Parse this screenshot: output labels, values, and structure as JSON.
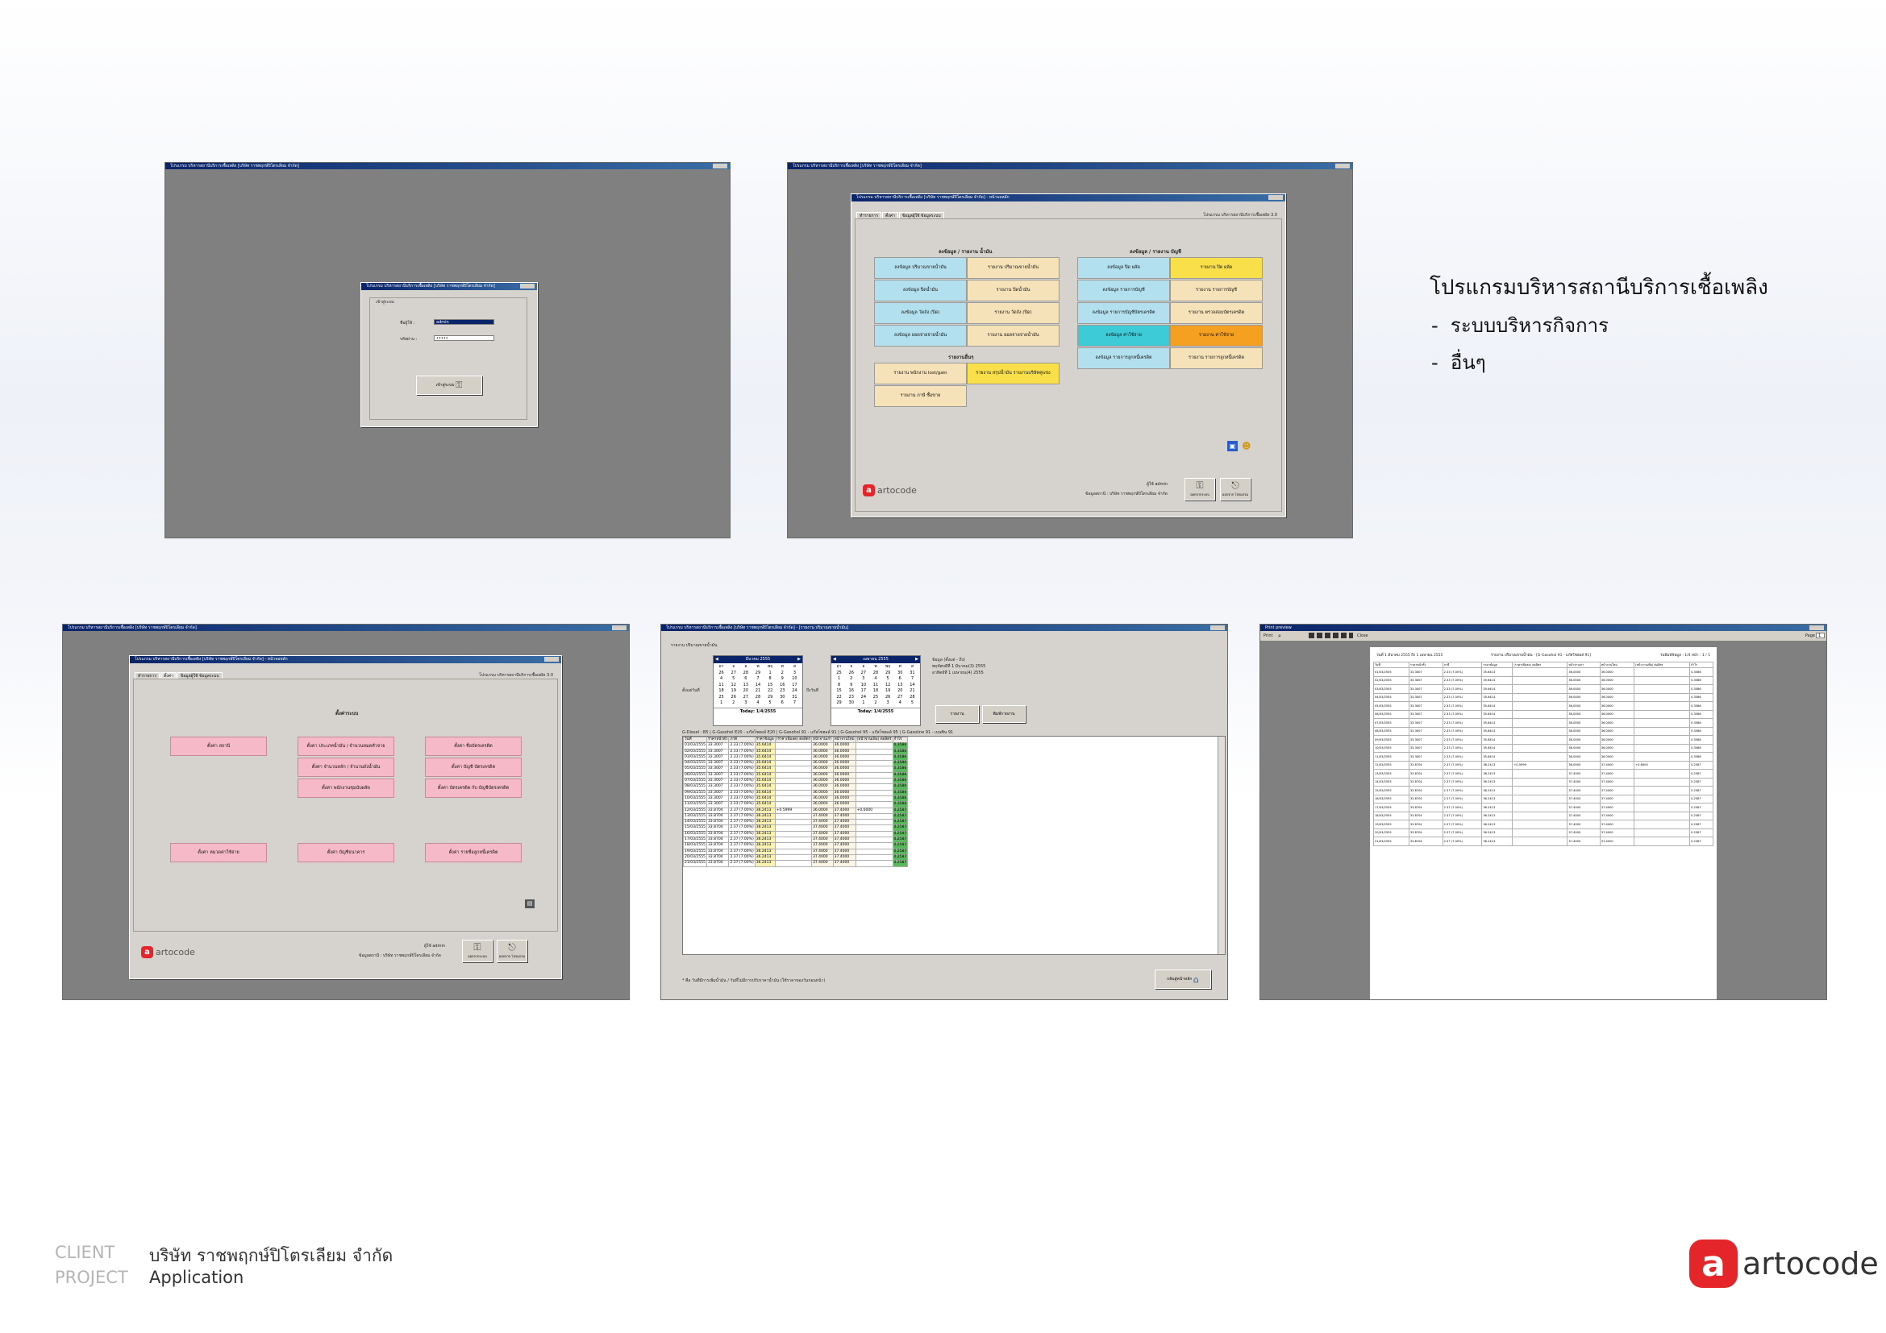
{
  "description_block": {
    "heading": "โปรแกรมบริหารสถานีบริการเชื้อเพลิง",
    "bullets": [
      "ระบบบริหารกิจการ",
      "อื่นๆ"
    ]
  },
  "footer": {
    "client_label": "CLIENT",
    "client_value": "บริษัท ราชพฤกษ์ปิโตรเลียม จำกัด",
    "project_label": "PROJECT",
    "project_value": "Application",
    "brand": "artocode",
    "brand_mark": "a"
  },
  "colors": {
    "brand_red": "#e4252a",
    "desktop_gray": "#808080",
    "dialog_face": "#d6d3ce",
    "titlebar_blue": "#0a246a",
    "menu_blue": "#b3e0ee",
    "menu_beige": "#f6e2b8",
    "menu_yellow": "#f9e04a",
    "menu_cyan": "#3ecbd8",
    "menu_orange": "#f5a020",
    "menu_pink": "#f6b9c8"
  },
  "screen1": {
    "window_title": "โปรแกรม บริหารสถานีบริการเชื้อเพลิง [บริษัท ราชพฤกษ์ปิโตรเลียม จำกัด]",
    "dialog_title": "โปรแกรม บริหารสถานีบริการเชื้อเพลิง [บริษัท ราชพฤกษ์ปิโตรเลียม จำกัด]",
    "group_label": "เข้าสู่ระบบ",
    "username_label": "ชื่อผู้ใช้ :",
    "username_value": "admin",
    "password_label": "รหัสผ่าน :",
    "password_value": "•••••",
    "login_button": "เข้าสู่ระบบ"
  },
  "screen2": {
    "window_title": "โปรแกรม บริหารสถานีบริการเชื้อเพลิง [บริษัท ราชพฤกษ์ปิโตรเลียม จำกัด]",
    "dialog_title": "โปรแกรม บริหารสถานีบริการเชื้อเพลิง [บริษัท ราชพฤกษ์ปิโตรเลียม จำกัด] - หน้าจอหลัก",
    "tabs": [
      "ทำรายการ",
      "ตั้งค่า",
      "ข้อมูลผู้ใช้ ข้อมูลระบบ"
    ],
    "version_text": "โปรแกรม บริหารสถานีบริการเชื้อเพลิง 3.0",
    "section_fuel": "ลงข้อมูล / รายงาน น้ำมัน",
    "section_accounting": "ลงข้อมูล / รายงาน บัญชี",
    "section_other": "รายงานอื่นๆ",
    "fuel_left": [
      "ลงข้อมูล ปริมาณขายน้ำมัน",
      "ลงข้อมูล ปิดน้ำมัน",
      "ลงข้อมูล วัดถัง (ปิด)",
      "ลงข้อมูล ยอดจ่ายจ่ายน้ำมัน"
    ],
    "fuel_right": [
      "รายงาน ปริมาณขายน้ำมัน",
      "รายงาน ปิดน้ำมัน",
      "รายงาน วัดถัง (ปิด)",
      "รายงาน ยอดจ่ายจ่ายน้ำมัน"
    ],
    "acct_left": [
      "ลงข้อมูล ปิด ผลัด",
      "ลงข้อมูล รายการบัญชี",
      "ลงข้อมูล รายการบัญชีบัตรเครดิต",
      "ลงข้อมูล ค่าใช้จ่าย",
      "ลงข้อมูล รายการลูกหนี้เครดิต"
    ],
    "acct_right": [
      "รายงาน ปิด ผลัด",
      "รายงาน รายการบัญชี",
      "รายงาน ตรวจสอบบัตรเครดิต",
      "รายงาน ค่าใช้จ่าย",
      "รายงาน รายการลูกหนี้เครดิต"
    ],
    "other_1": "รายงาน พนักงาน lost/gain",
    "other_2": "รายงาน สรุปน้ำมัน รายงานบริษัทคู่แข่ง",
    "other_3": "รายงาน ภาษี ซื้อขาย",
    "user_label": "ผู้ใช้",
    "user_value": "admin",
    "company_line": "ข้อมูลสถานี : บริษัท ราชพฤกษ์ปิโตรเลียม จำกัด",
    "btn_logout": "ออกจากระบบ",
    "btn_exit": "ออกจาก โปรแกรม",
    "logo_text": "artocode"
  },
  "screen3": {
    "window_title": "โปรแกรม บริหารสถานีบริการเชื้อเพลิง [บริษัท ราชพฤกษ์ปิโตรเลียม จำกัด]",
    "dialog_title": "โปรแกรม บริหารสถานีบริการเชื้อเพลิง [บริษัท ราชพฤกษ์ปิโตรเลียม จำกัด] - หน้าจอหลัก",
    "tabs": [
      "ทำรายการ",
      "ตั้งค่า",
      "ข้อมูลผู้ใช้ ข้อมูลระบบ"
    ],
    "version_text": "โปรแกรม บริหารสถานีบริการเชื้อเพลิง 3.0",
    "section_title": "ตั้งค่าระบบ",
    "buttons": [
      "ตั้งค่า สถานี",
      "ตั้งค่า ประเภทน้ำมัน / จำนวนหมดหัวจ่าย",
      "ตั้งค่า ชื่อบัตรเครดิต",
      "ตั้งค่า จำนวนหลัก / จำนวนถังน้ำมัน",
      "ตั้งค่า บัญชี บัตรเครดิต",
      "ตั้งค่า พนักงานชุมนับผลัด",
      "ตั้งค่า บัตรเครดิต กับ บัญชีบัตรเครดิต",
      "ตั้งค่า หมวดค่าใช้จ่าย",
      "ตั้งค่า บัญชีธนาคาร",
      "ตั้งค่า รายชื่อลูกหนี้เครดิต"
    ],
    "user_label": "ผู้ใช้",
    "user_value": "admin",
    "company_line": "ข้อมูลสถานี : บริษัท ราชพฤกษ์ปิโตรเลียม จำกัด",
    "btn_logout": "ออกจากระบบ",
    "btn_exit": "ออกจาก โปรแกรม",
    "logo_text": "artocode"
  },
  "screen4": {
    "window_title": "โปรแกรม บริหารสถานีบริการเชื้อเพลิง [บริษัท ราชพฤกษ์ปิโตรเลียม จำกัด] - [รายงาน ปริมาณขายน้ำมัน]",
    "report_label": "รายงาน ปริมาณขายน้ำมัน",
    "from_label": "ตั้งแต่วันที่",
    "to_label": "ถึงวันที่",
    "cal1": {
      "month": "มีนาคม 2555",
      "days": [
        "อา",
        "จ",
        "อ",
        "พ",
        "พฤ",
        "ศ",
        "ส"
      ],
      "dates": [
        "26",
        "27",
        "28",
        "29",
        "1",
        "2",
        "3",
        "4",
        "5",
        "6",
        "7",
        "8",
        "9",
        "10",
        "11",
        "12",
        "13",
        "14",
        "15",
        "16",
        "17",
        "18",
        "19",
        "20",
        "21",
        "22",
        "23",
        "24",
        "25",
        "26",
        "27",
        "28",
        "29",
        "30",
        "31",
        "1",
        "2",
        "3",
        "4",
        "5",
        "6",
        "7"
      ],
      "today": "Today: 1/4/2555"
    },
    "cal2": {
      "month": "เมษายน 2555",
      "days": [
        "อา",
        "จ",
        "อ",
        "พ",
        "พฤ",
        "ศ",
        "ส"
      ],
      "dates": [
        "25",
        "26",
        "27",
        "28",
        "29",
        "30",
        "31",
        "1",
        "2",
        "3",
        "4",
        "5",
        "6",
        "7",
        "8",
        "9",
        "10",
        "11",
        "12",
        "13",
        "14",
        "15",
        "16",
        "17",
        "18",
        "19",
        "20",
        "21",
        "22",
        "23",
        "24",
        "25",
        "26",
        "27",
        "28",
        "29",
        "30",
        "1",
        "2",
        "3",
        "4",
        "5"
      ],
      "today": "Today: 1/4/2555"
    },
    "info_lines": [
      "ข้อมูล (ตั้งแต่ - ถึง)",
      "พฤหัสบดีที่ 1 มีนาคม(3) 2555",
      "อาทิตย์ที่ 1 เมษายน(4) 2555"
    ],
    "btn_report": "รายงาน",
    "btn_print": "พิมพ์รายงาน",
    "fuel_tabs_text": "G-Diesel : B5 | G-Gasohol E20 - แก๊สโซฮอล์ E20 | G-Gasohol 91 - แก๊สโซฮอล์ 91 | G-Gasohol 95 - แก๊สโซฮอล์ 95 | G-Gasoline 91 - เบนซิน 91",
    "columns": [
      "วันที่",
      "ราคาหน้าตั๋ว",
      "ภาษี",
      "ราคาข้อมูล",
      "(ราคาเพิ่มลด) ต่อลิตร",
      "หน้าจานเก่า",
      "หน้าจานใหม่",
      "(หน้าจานเพิ่ม) ต่อลิตร",
      "กำไร"
    ],
    "rows": [
      [
        "01/03/2555",
        "33.3007",
        "2.33 (7.00%)",
        "35.6414",
        "",
        "36.0000",
        "36.0000",
        "",
        "0.3586"
      ],
      [
        "02/03/2555",
        "33.3007",
        "2.33 (7.00%)",
        "35.6414",
        "",
        "36.0000",
        "36.0000",
        "",
        "0.3586"
      ],
      [
        "03/03/2555",
        "33.3007",
        "2.33 (7.00%)",
        "35.6414",
        "",
        "36.0000",
        "36.0000",
        "",
        "0.3586"
      ],
      [
        "04/03/2555",
        "33.3007",
        "2.33 (7.00%)",
        "35.6414",
        "",
        "36.0000",
        "36.0000",
        "",
        "0.3586"
      ],
      [
        "05/03/2555",
        "33.3007",
        "2.33 (7.00%)",
        "35.6414",
        "",
        "36.0000",
        "36.0000",
        "",
        "0.3586"
      ],
      [
        "06/03/2555",
        "33.3007",
        "2.33 (7.00%)",
        "35.6414",
        "",
        "36.0000",
        "36.0000",
        "",
        "0.3586"
      ],
      [
        "07/03/2555",
        "33.3007",
        "2.33 (7.00%)",
        "35.6414",
        "",
        "36.0000",
        "36.0000",
        "",
        "0.3586"
      ],
      [
        "08/03/2555",
        "33.3007",
        "2.33 (7.00%)",
        "35.6414",
        "",
        "36.0000",
        "36.0000",
        "",
        "0.3586"
      ],
      [
        "09/03/2555",
        "33.3007",
        "2.33 (7.00%)",
        "35.6414",
        "",
        "36.0000",
        "36.0000",
        "",
        "0.3586"
      ],
      [
        "10/03/2555",
        "33.3007",
        "2.33 (7.00%)",
        "35.6414",
        "",
        "36.0000",
        "36.0000",
        "",
        "0.3586"
      ],
      [
        "11/03/2555",
        "33.3007",
        "2.33 (7.00%)",
        "35.6414",
        "",
        "36.0000",
        "36.0000",
        "",
        "0.3586"
      ],
      [
        "12/03/2555",
        "33.8704",
        "2.37 (7.00%)",
        "36.2413",
        "+0.5999",
        "36.0000",
        "37.4000",
        "+0.6000",
        "0.2587"
      ],
      [
        "13/03/2555",
        "33.8704",
        "2.37 (7.00%)",
        "36.2413",
        "",
        "37.4000",
        "37.4000",
        "",
        "0.2587"
      ],
      [
        "14/03/2555",
        "33.8704",
        "2.37 (7.00%)",
        "36.2413",
        "",
        "37.4000",
        "37.4000",
        "",
        "0.2587"
      ],
      [
        "15/03/2555",
        "33.8704",
        "2.37 (7.00%)",
        "36.2413",
        "",
        "37.4000",
        "37.4000",
        "",
        "0.2587"
      ],
      [
        "16/03/2555",
        "33.8704",
        "2.37 (7.00%)",
        "36.2413",
        "",
        "37.4000",
        "37.4000",
        "",
        "0.2587"
      ],
      [
        "17/03/2555",
        "33.8704",
        "2.37 (7.00%)",
        "36.2413",
        "",
        "37.4000",
        "37.4000",
        "",
        "0.2587"
      ],
      [
        "18/03/2555",
        "33.8704",
        "2.37 (7.00%)",
        "36.2413",
        "",
        "37.4000",
        "37.4000",
        "",
        "0.2587"
      ],
      [
        "19/03/2555",
        "33.8704",
        "2.37 (7.00%)",
        "36.2413",
        "",
        "37.4000",
        "37.4000",
        "",
        "0.2587"
      ],
      [
        "20/03/2555",
        "33.8704",
        "2.37 (7.00%)",
        "36.2413",
        "",
        "37.4000",
        "37.4000",
        "",
        "0.2587"
      ],
      [
        "21/03/2555",
        "33.8704",
        "2.37 (7.00%)",
        "36.2413",
        "",
        "37.4000",
        "37.4000",
        "",
        "0.2587"
      ]
    ],
    "footer_note": "* คือ วันที่มีการเพิ่มน้ำมัน / วันที่ไม่มีการปรับราคาน้ำมัน (ใช้ราคาของวันก่อนหน้า)",
    "btn_back": "กลับสู่หน้าหลัก"
  },
  "screen5": {
    "window_title": "Print preview",
    "toolbar": [
      "Print",
      "Close"
    ],
    "page_label": "Page",
    "page_value": "1",
    "doc_header_left": "วันที่ 1 มีนาคม 2555 ถึง 1 เมษายน 2555",
    "doc_header_center": "รายงาน ปริมาณขายน้ำมัน - [G-Gasohol 91 - แก๊สโซฮอล์ 91]",
    "doc_header_right": "วันพิมพ์ข้อมูล : 1/4 หน้า : 1 / 1",
    "columns": [
      "วันที่",
      "ราคาหน้าตั๋ว",
      "ภาษี",
      "ราคาข้อมูล",
      "(ราคาเพิ่มลด) ต่อลิตร",
      "หน้าจานเก่า",
      "หน้าจานใหม่",
      "(หน้าจานเพิ่ม) ต่อลิตร",
      "กำไร"
    ]
  }
}
